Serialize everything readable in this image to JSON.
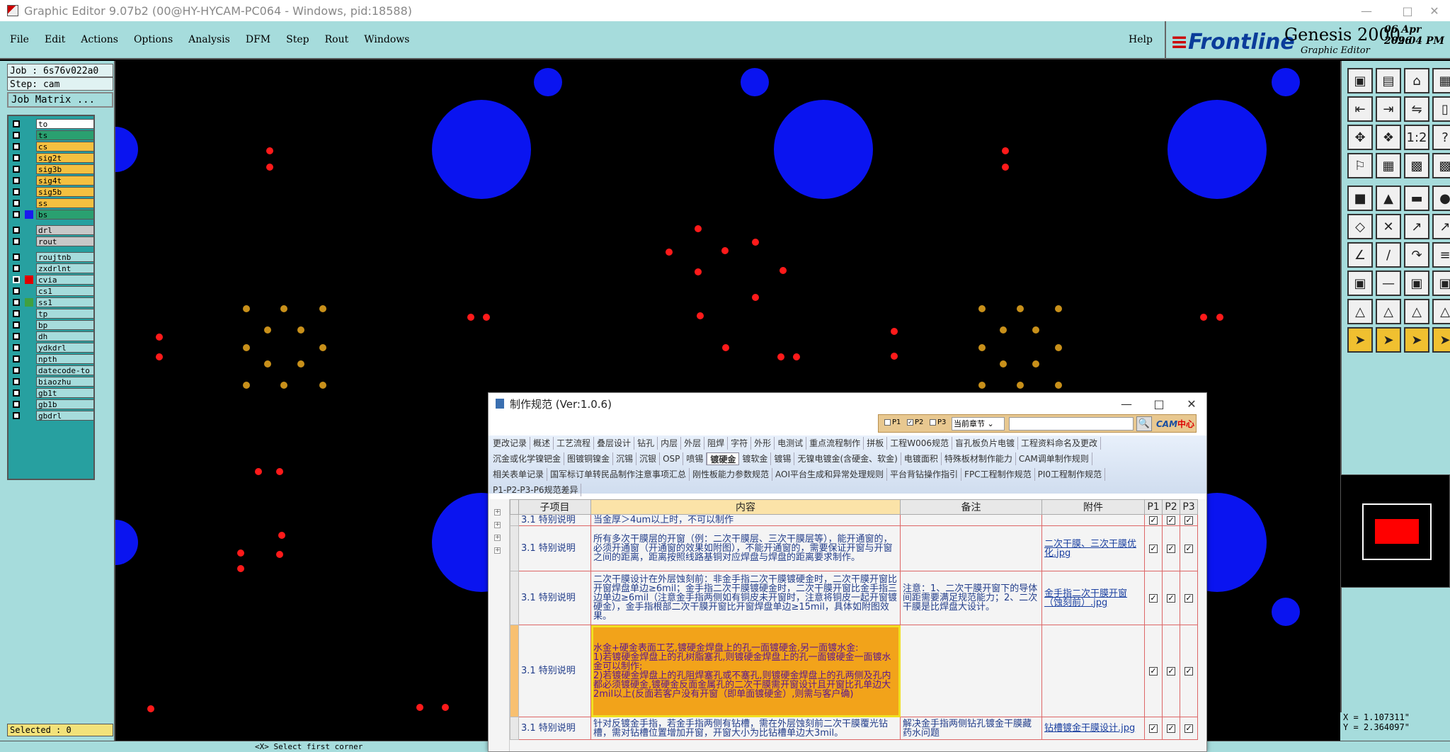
{
  "window": {
    "title": "Graphic Editor 9.07b2 (00@HY-HYCAM-PC064 - Windows, pid:18588)"
  },
  "menu": {
    "items": [
      "File",
      "Edit",
      "Actions",
      "Options",
      "Analysis",
      "DFM",
      "Step",
      "Rout",
      "Windows"
    ],
    "help": "Help"
  },
  "brand": {
    "logo": "Frontline",
    "product": "Genesis 2000",
    "subtitle": "Graphic Editor",
    "date": "06 Apr 2026",
    "time": "09:04 PM"
  },
  "job": {
    "job_line": "Job : 6s76v022a0",
    "step_line": "Step: cam",
    "matrix_button": "Job Matrix ..."
  },
  "layers": [
    {
      "name": "to",
      "color": "#ffffff",
      "swatch": ""
    },
    {
      "name": "ts",
      "color": "#2aa070",
      "swatch": ""
    },
    {
      "name": "cs",
      "color": "#f4c040",
      "swatch": ""
    },
    {
      "name": "sig2t",
      "color": "#f4c040",
      "swatch": ""
    },
    {
      "name": "sig3b",
      "color": "#f4c040",
      "swatch": ""
    },
    {
      "name": "sig4t",
      "color": "#f4c040",
      "swatch": ""
    },
    {
      "name": "sig5b",
      "color": "#f4c040",
      "swatch": ""
    },
    {
      "name": "ss",
      "color": "#f4c040",
      "swatch": ""
    },
    {
      "name": "bs",
      "color": "#2aa070",
      "swatch": "#1a1aee"
    },
    {
      "name": "drl",
      "color": "#c8c8c8",
      "swatch": "",
      "gap": true
    },
    {
      "name": "rout",
      "color": "#c8c8c8",
      "swatch": ""
    },
    {
      "name": "roujtnb",
      "color": "#a6dcdc",
      "swatch": "",
      "gap": true
    },
    {
      "name": "zxdrlnt",
      "color": "#a6dcdc",
      "swatch": ""
    },
    {
      "name": "cvia",
      "color": "#a6dcdc",
      "swatch": "#e00000",
      "active": true
    },
    {
      "name": "cs1",
      "color": "#a6dcdc",
      "swatch": ""
    },
    {
      "name": "ss1",
      "color": "#a6dcdc",
      "swatch": "#40a040"
    },
    {
      "name": "tp",
      "color": "#a6dcdc",
      "swatch": ""
    },
    {
      "name": "bp",
      "color": "#a6dcdc",
      "swatch": ""
    },
    {
      "name": "dh",
      "color": "#a6dcdc",
      "swatch": ""
    },
    {
      "name": "ydkdrl",
      "color": "#a6dcdc",
      "swatch": ""
    },
    {
      "name": "npth",
      "color": "#a6dcdc",
      "swatch": ""
    },
    {
      "name": "datecode-to",
      "color": "#a6dcdc",
      "swatch": ""
    },
    {
      "name": "biaozhu",
      "color": "#a6dcdc",
      "swatch": ""
    },
    {
      "name": "gb1t",
      "color": "#a6dcdc",
      "swatch": ""
    },
    {
      "name": "gb1b",
      "color": "#a6dcdc",
      "swatch": ""
    },
    {
      "name": "gbdrl",
      "color": "#a6dcdc",
      "swatch": ""
    }
  ],
  "selected": "Selected : 0",
  "coords": {
    "x": "X = 1.107311\"",
    "y": "Y = 2.364097\""
  },
  "status": {
    "prompt": "<X>  Select first corner"
  },
  "dialog": {
    "title": "制作规范 (Ver:1.0.6)",
    "filters": [
      "P1",
      "P2",
      "P3"
    ],
    "filter_checked": [
      false,
      true,
      false
    ],
    "scope": "当前章节",
    "cam_logo": "CAM",
    "cam_logo_cn": "中心",
    "tab_rows": [
      [
        "更改记录",
        "概述",
        "工艺流程",
        "叠层设计",
        "钻孔",
        "内层",
        "外层",
        "阻焊",
        "字符",
        "外形",
        "电测试",
        "重点流程制作",
        "拼板",
        "工程W006规范",
        "盲孔板负片电镀",
        "工程资料命名及更改"
      ],
      [
        "沉金或化学镍钯金",
        "图镀铜镍金",
        "沉锡",
        "沉银",
        "OSP",
        "喷锡",
        "镀硬金",
        "镀软金",
        "镀锡",
        "无镍电镀金(含硬金、软金)",
        "电镀面积",
        "特殊板材制作能力",
        "CAM调单制作规则"
      ],
      [
        "相关表单记录",
        "国军标订单转民品制作注意事项汇总",
        "刚性板能力参数规范",
        "AOI平台生成和异常处理规则",
        "平台背钻操作指引",
        "FPC工程制作规范",
        "PI0工程制作规范"
      ],
      [
        "P1-P2-P3-P6规范差异"
      ]
    ],
    "active_tab": "镀硬金",
    "columns": [
      "子项目",
      "内容",
      "备注",
      "附件",
      "P1",
      "P2",
      "P3"
    ],
    "rows": [
      {
        "sub": "3.1 特别说明",
        "content": "当金厚＞4um以上时，不可以制作",
        "note": "",
        "attach": "",
        "p": [
          true,
          true,
          true
        ]
      },
      {
        "sub": "3.1 特别说明",
        "content": "所有多次干膜层的开窗（例：二次干膜层、三次干膜层等），能开通窗的，必须开通窗（开通窗的效果如附图），不能开通窗的，需要保证开窗与开窗之间的距离，距离按照线路基铜对应焊盘与焊盘的距离要求制作。",
        "note": "",
        "attach": "二次干膜、三次干膜优化.jpg",
        "p": [
          true,
          true,
          true
        ]
      },
      {
        "sub": "3.1 特别说明",
        "content": "二次干膜设计在外层蚀刻前：非金手指二次干膜镀硬金时，二次干膜开窗比开窗焊盘单边≥6mil；金手指二次干膜镀硬金时，二次干膜开窗比金手指三边单边≥6mil（注意金手指两侧如有铜皮未开窗时，注意将铜皮一起开窗镀硬金），金手指根部二次干膜开窗比开窗焊盘单边≥15mil，具体如附图效果。",
        "note": "注意：1、二次干膜开窗下的导体间距需要满足规范能力；2、二次干膜是比焊盘大设计。",
        "attach": "金手指二次干膜开窗（蚀刻前）.jpg",
        "p": [
          true,
          true,
          true
        ]
      },
      {
        "sub": "3.1 特别说明",
        "content": "水金+硬金表面工艺,镀硬金焊盘上的孔一面镀硬金,另一面镀水金:\n1)若镀硬金焊盘上的孔树脂塞孔,则镀硬金焊盘上的孔一面镀硬金一面镀水金可以制作;\n2)若镀硬金焊盘上的孔阻焊塞孔或不塞孔,则镀硬金焊盘上的孔两侧及孔内都必须镀硬金,镀硬金反面金属孔的二次干膜需开窗设计且开窗比孔单边大2mil以上(反面若客户没有开窗（即单面镀硬金）,则需与客户确)",
        "note": "",
        "attach": "",
        "p": [
          true,
          true,
          true
        ],
        "highlight": true
      },
      {
        "sub": "3.1 特别说明",
        "content": "针对反镀金手指，若金手指两侧有钻槽，需在外层蚀刻前二次干膜覆光钻槽，需对钻槽位置增加开窗，开窗大小为比钻槽单边大3mil。",
        "note": "解决金手指两侧钻孔镀金干膜藏药水问题",
        "attach": "钻槽镀金干膜设计.jpg",
        "p": [
          true,
          true,
          true
        ]
      }
    ]
  }
}
